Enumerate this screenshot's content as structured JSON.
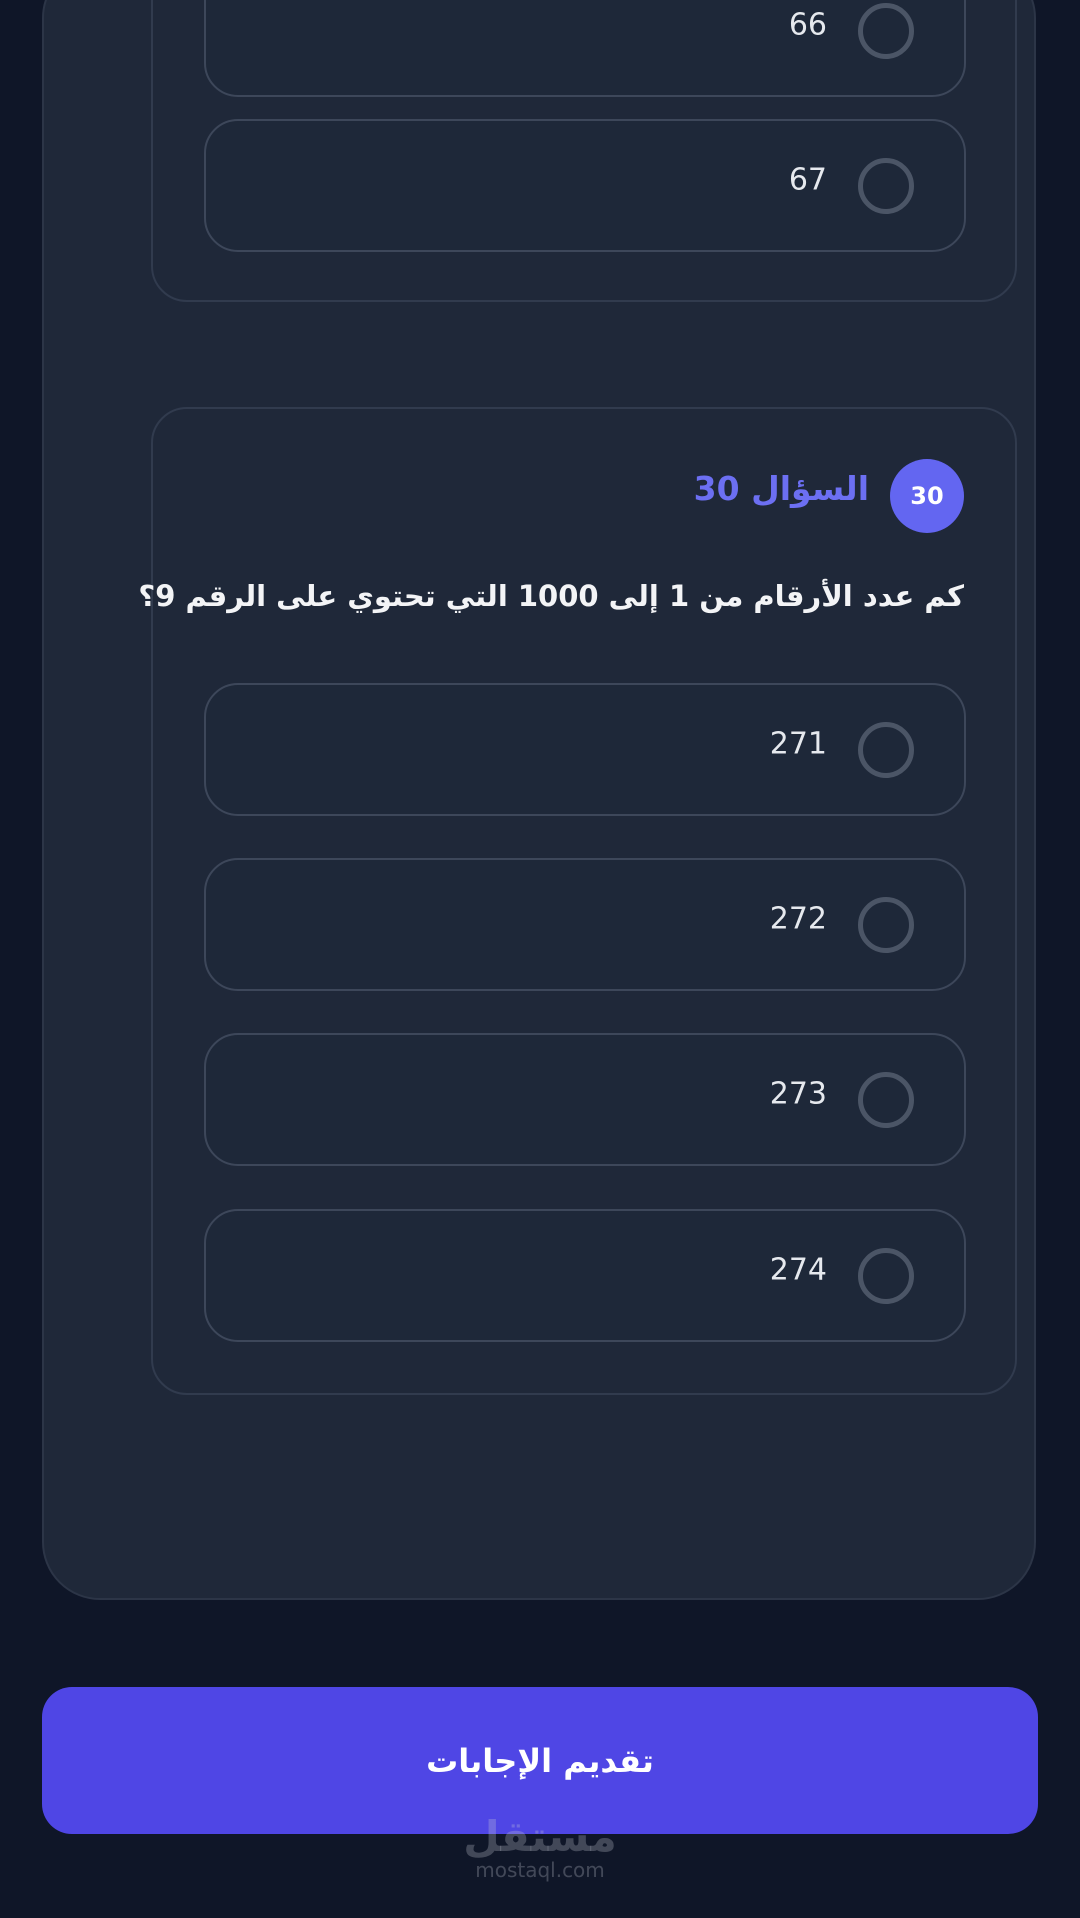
{
  "previous_question": {
    "options": [
      {
        "label": "66"
      },
      {
        "label": "67"
      }
    ]
  },
  "question_30": {
    "badge": "30",
    "title": "السؤال 30",
    "text": "كم عدد الأرقام من 1 إلى 1000 التي تحتوي على الرقم 9؟",
    "options": [
      {
        "label": "271"
      },
      {
        "label": "272"
      },
      {
        "label": "273"
      },
      {
        "label": "274"
      }
    ]
  },
  "submit": {
    "label": "تقديم الإجابات"
  },
  "watermark": {
    "arabic": "مستقل",
    "url": "mostaql.com"
  },
  "colors": {
    "background": "#0f1628",
    "card": "#1f2839",
    "accent": "#6366f1",
    "submit": "#4f46e5"
  }
}
